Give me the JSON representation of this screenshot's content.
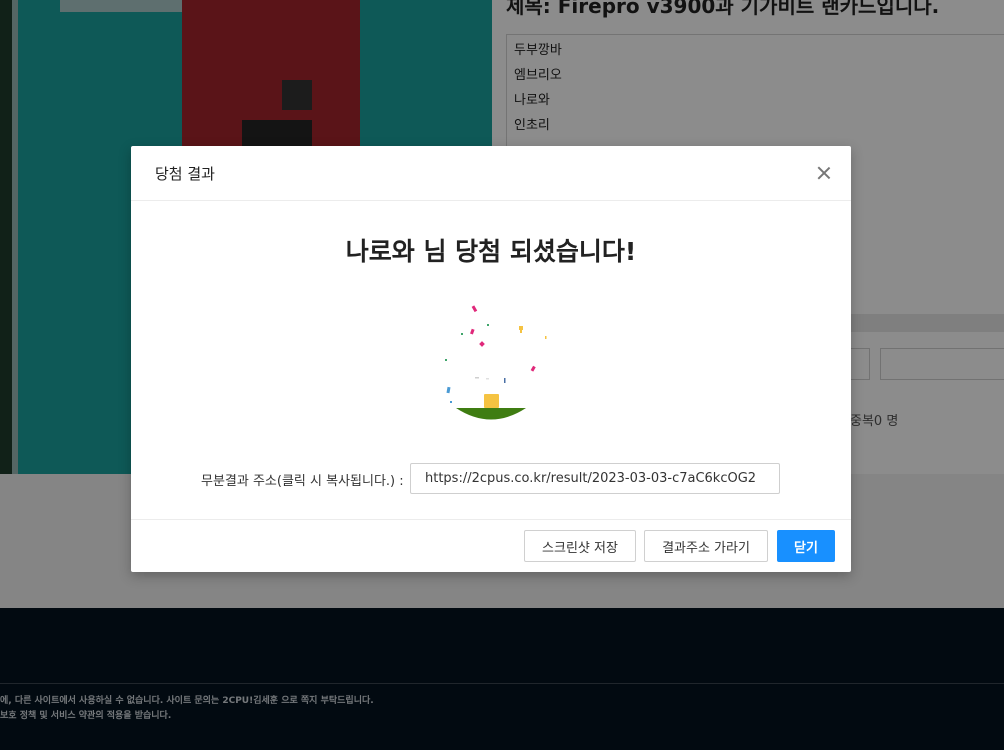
{
  "background": {
    "post_title": "제목: Firepro v3900과 기가비트 랜카드입니다.",
    "entries": [
      "두부깡바",
      "엠브리오",
      "나로와",
      "인초리"
    ],
    "duplicate_text": "중복0 명",
    "footer": {
      "line1": "에, 다른 사이트에서 사용하실 수 없습니다. 사이트 문의는 2CPU!김세훈 으로 쪽지 부탁드립니다.",
      "line2": "보호 정책 및 서비스 약관의 적용을 받습니다."
    }
  },
  "modal": {
    "title": "당첨 결과",
    "winner_message": "나로와 님 당첨 되셨습니다!",
    "url_label": "무분결과 주소(클릭 시 복사됩니다.) :",
    "url_value": "https://2cpus.co.kr/result/2023-03-03-c7aC6kcOG2",
    "buttons": {
      "screenshot": "스크린샷 저장",
      "goto_result": "결과주소 가라기",
      "close": "닫기"
    }
  },
  "colors": {
    "primary": "#1890ff",
    "footer_bg": "#041320",
    "confetti_pink": "#e0287a",
    "confetti_yellow": "#f5c342",
    "ground_green": "#3f7d12"
  },
  "icons": {
    "close": "close-x-icon",
    "celebration": "confetti-celebration-icon"
  }
}
